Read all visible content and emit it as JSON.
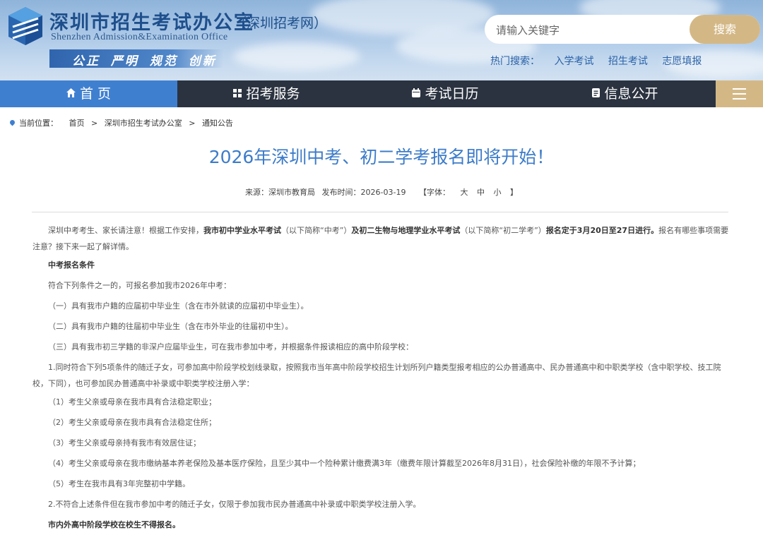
{
  "header": {
    "title": "深圳市招生考试办公室",
    "subtitle": "（深圳招考网）",
    "english": "Shenzhen Admission&Examination Office",
    "slogan": "公正 严明 规范 创新",
    "search": {
      "placeholder": "请输入关键字",
      "button": "搜索"
    },
    "hot_label": "热门搜索：",
    "hot_keywords": [
      "入学考试",
      "招生考试",
      "志愿填报"
    ]
  },
  "nav": {
    "items": [
      {
        "label": "首 页",
        "icon": "home-icon"
      },
      {
        "label": "招考服务",
        "icon": "grid-icon"
      },
      {
        "label": "考试日历",
        "icon": "calendar-icon"
      },
      {
        "label": "信息公开",
        "icon": "document-icon"
      }
    ],
    "menu_icon": "hamburger-icon",
    "colors": {
      "bar": "#2b3340",
      "active": "#3f7fd0",
      "accent": "#d3b886"
    }
  },
  "breadcrumb": {
    "label": "当前位置：",
    "items": [
      "首页",
      "深圳市招生考试办公室",
      "通知公告"
    ],
    "separator": ">"
  },
  "article": {
    "title": "2026年深圳中考、初二学考报名即将开始！",
    "meta": {
      "source": "来源：深圳市教育局",
      "date": "发布时间：2026-03-19",
      "font_label": "【字体：",
      "sizes": [
        "大",
        "中",
        "小"
      ],
      "font_end": "】"
    },
    "intro": {
      "t1": "深圳中考考生、家长请注意！根据工作安排，",
      "b1": "我市初中学业水平考试",
      "t2": "（以下简称“中考”）",
      "b2": "及初二生物与地理学业水平考试",
      "t3": "（以下简称“初二学考”）",
      "b3": "报名定于3月20日至27日进行。",
      "t4": "报名有哪些事项需要注意？接下来一起了解详情。"
    },
    "section1": "中考报名条件",
    "p1": "符合下列条件之一的，可报名参加我市2026年中考：",
    "p2": "（一）具有我市户籍的应届初中毕业生（含在市外就读的应届初中毕业生）。",
    "p3": "（二）具有我市户籍的往届初中毕业生（含在市外毕业的往届初中生）。",
    "p4": "（三）具有我市初三学籍的非深户应届毕业生，可在我市参加中考，并根据条件报读相应的高中阶段学校：",
    "p5": "1.同时符合下列5项条件的随迁子女，可参加高中阶段学校划线录取，按照我市当年高中阶段学校招生计划所列户籍类型报考相应的公办普通高中、民办普通高中和中职类学校（含中职学校、技工院校，下同），也可参加民办普通高中补录或中职类学校注册入学：",
    "p6": "（1）考生父亲或母亲在我市具有合法稳定职业；",
    "p7": "（2）考生父亲或母亲在我市具有合法稳定住所；",
    "p8": "（3）考生父亲或母亲持有我市有效居住证；",
    "p9": "（4）考生父亲或母亲在我市缴纳基本养老保险及基本医疗保险，且至少其中一个险种累计缴费满3年（缴费年限计算截至2026年8月31日），社会保险补缴的年限不予计算；",
    "p10": "（5）考生在我市具有3年完整初中学籍。",
    "p11": "2.不符合上述条件但在我市参加中考的随迁子女，仅限于参加我市民办普通高中补录或中职类学校注册入学。",
    "p12": "市内外高中阶段学校在校生不得报名。"
  }
}
